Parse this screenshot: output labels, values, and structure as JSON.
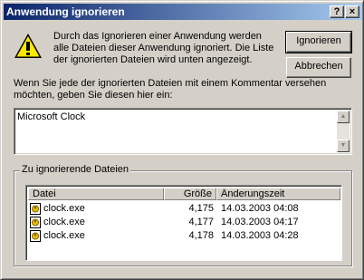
{
  "window": {
    "title": "Anwendung ignorieren",
    "help_button": "?",
    "close_button": "×",
    "title_gradient": [
      "#0a246a",
      "#a6caf0"
    ]
  },
  "message": "Durch das Ignorieren einer Anwendung werden alle Dateien dieser Anwendung ignoriert. Die Liste der ignorierten Dateien wird unten angezeigt.",
  "buttons": {
    "ignore": "Ignorieren",
    "cancel": "Abbrechen"
  },
  "prompt": "Wenn Sie jede der ignorierten Dateien mit einem Kommentar versehen möchten, geben Sie diesen hier ein:",
  "comment_value": "Microsoft Clock",
  "group_label": "Zu ignorierende Dateien",
  "table": {
    "columns": [
      "Datei",
      "Größe",
      "Änderungszeit"
    ],
    "rows": [
      {
        "file": "clock.exe",
        "size": "4,175",
        "modified": "14.03.2003 04:08"
      },
      {
        "file": "clock.exe",
        "size": "4,177",
        "modified": "14.03.2003 04:17"
      },
      {
        "file": "clock.exe",
        "size": "4,178",
        "modified": "14.03.2003 04:28"
      }
    ]
  },
  "icons": {
    "warning": "warning-triangle-icon",
    "file": "executable-file-icon",
    "scroll_up": "scroll-up-arrow",
    "scroll_down": "scroll-down-arrow"
  }
}
